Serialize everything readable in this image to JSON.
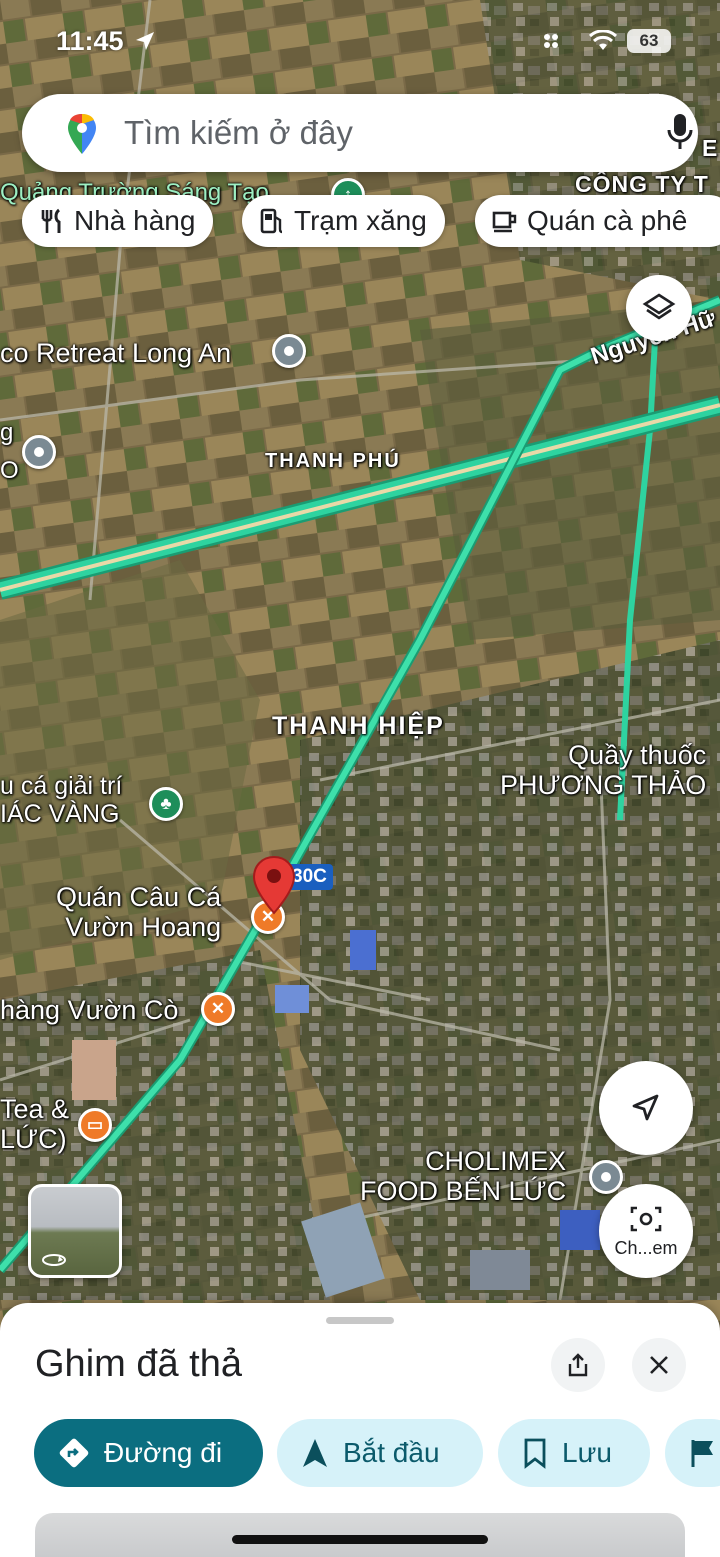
{
  "status_bar": {
    "time": "11:45",
    "battery": "63"
  },
  "search": {
    "placeholder": "Tìm kiếm ở đây"
  },
  "chips": [
    {
      "label": "Nhà hàng",
      "icon": "fork-knife-icon"
    },
    {
      "label": "Trạm xăng",
      "icon": "gas-station-icon"
    },
    {
      "label": "Quán cà phê",
      "icon": "coffee-cup-icon"
    }
  ],
  "map": {
    "places": [
      {
        "text": "THANH PHÚ"
      },
      {
        "text": "THANH HIỆP"
      }
    ],
    "pois": [
      {
        "text": "co Retreat Long An",
        "icon": "pin-icon"
      },
      {
        "text": "Quán Câu Cá\nVườn Hoang",
        "icon": "restaurant-icon"
      },
      {
        "text": "hàng Vườn Cò",
        "icon": "restaurant-icon"
      },
      {
        "text": "Tea &\nLỨC)",
        "icon": "coffee-icon"
      },
      {
        "text": "u cá giải trí\nIÁC VÀNG",
        "icon": "park-icon"
      },
      {
        "text": "Quầy thuốc\nPHƯƠNG THẢO"
      },
      {
        "text": "CHOLIMEX\nFOOD BẾN LỨC",
        "icon": "pin-icon"
      }
    ],
    "partial_labels": {
      "top_left": "Quảng Trường Sáng Tạo",
      "top_right": "CÔNG TY T",
      "top_right_e": "E",
      "left_g": "g",
      "left_o": "O",
      "road": "Nguyễn Hữ",
      "road_badge": "30C"
    },
    "street_view_caption": "Ch...em"
  },
  "sheet": {
    "title": "Ghim đã thả",
    "actions": [
      {
        "label": "Đường đi",
        "icon": "directions-icon"
      },
      {
        "label": "Bắt đầu",
        "icon": "navigation-arrow-icon"
      },
      {
        "label": "Lưu",
        "icon": "bookmark-icon"
      },
      {
        "label": "",
        "icon": "flag-icon"
      }
    ]
  },
  "colors": {
    "primary": "#0b6e80",
    "secondary_bg": "#d6f2f9",
    "highway": "#2ed3a0",
    "pin": "#e53935"
  }
}
